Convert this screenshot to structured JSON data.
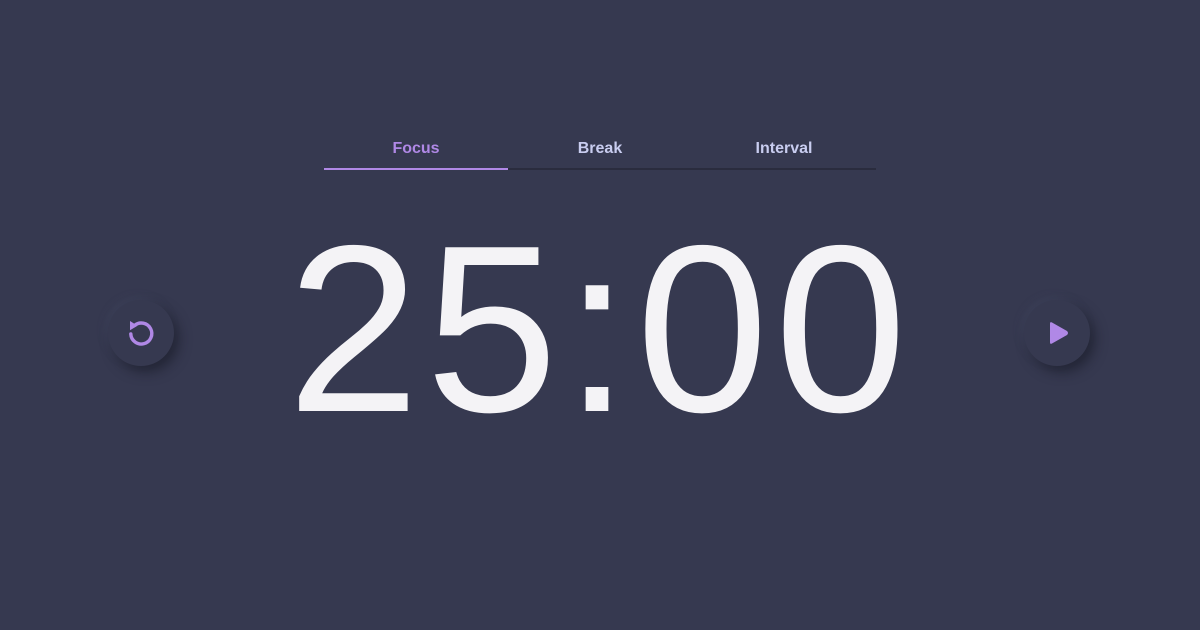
{
  "tabs": [
    {
      "label": "Focus",
      "active": true
    },
    {
      "label": "Break",
      "active": false
    },
    {
      "label": "Interval",
      "active": false
    }
  ],
  "timer": {
    "display": "25:00"
  },
  "controls": {
    "reset_icon": "reset-icon",
    "play_icon": "play-icon"
  },
  "colors": {
    "background": "#363950",
    "accent": "#b088e6",
    "tab_text": "#c9cdf0",
    "timer_text": "#f4f3f6"
  }
}
